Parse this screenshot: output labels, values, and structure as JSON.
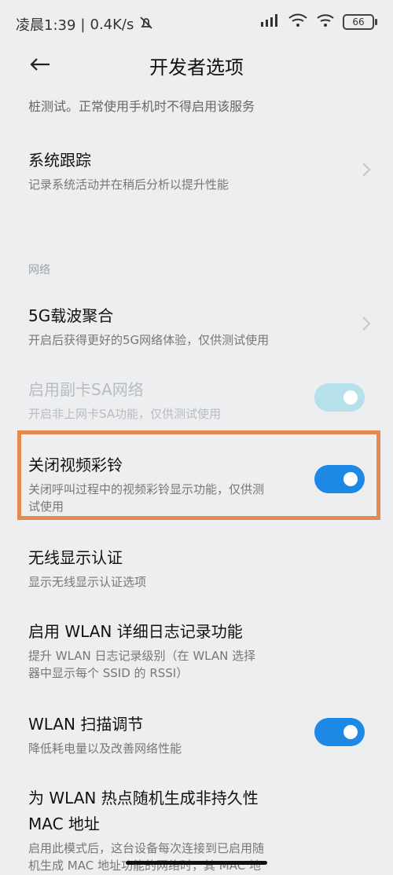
{
  "status_bar": {
    "time": "凌晨1:39",
    "network_speed": "0.4K/s",
    "battery_level": "66"
  },
  "header": {
    "title": "开发者选项"
  },
  "partial_text": "桩测试。正常使用手机时不得启用该服务",
  "items": [
    {
      "title": "系统跟踪",
      "subtitle": "记录系统活动并在稍后分析以提升性能",
      "control": "chevron"
    },
    {
      "section_label": "网络"
    },
    {
      "title": "5G载波聚合",
      "subtitle": "开启后获得更好的5G网络体验，仅供测试使用",
      "control": "chevron"
    },
    {
      "title": "启用副卡SA网络",
      "subtitle": "开启非上网卡SA功能，仅供测试使用",
      "control": "toggle",
      "enabled": false,
      "state": true
    },
    {
      "title": "关闭视频彩铃",
      "subtitle_line1": "关闭呼叫过程中的视频彩铃显示功能，仅供测",
      "subtitle_line2": "试使用",
      "control": "toggle",
      "enabled": true,
      "state": true,
      "highlighted": true
    },
    {
      "title": "无线显示认证",
      "subtitle": "显示无线显示认证选项",
      "control": "none"
    },
    {
      "title": "启用 WLAN 详细日志记录功能",
      "subtitle_line1": "提升 WLAN 日志记录级别（在 WLAN 选择",
      "subtitle_line2": "器中显示每个 SSID 的 RSSI）",
      "control": "none"
    },
    {
      "title": "WLAN 扫描调节",
      "subtitle": "降低耗电量以及改善网络性能",
      "control": "toggle",
      "enabled": true,
      "state": true
    },
    {
      "title_line1": "为 WLAN 热点随机生成非持久性",
      "title_line2": "MAC 地址",
      "subtitle_line1": "启用此模式后，这台设备每次连接到已启用随",
      "subtitle_line2": "机生成 MAC 地址功能的网络时，其 MAC 地",
      "control": "none"
    }
  ],
  "colors": {
    "background": "#eceef0",
    "accent": "#1e88e5",
    "highlight_border": "#e58a4e",
    "toggle_disabled": "#b6e0ea"
  }
}
